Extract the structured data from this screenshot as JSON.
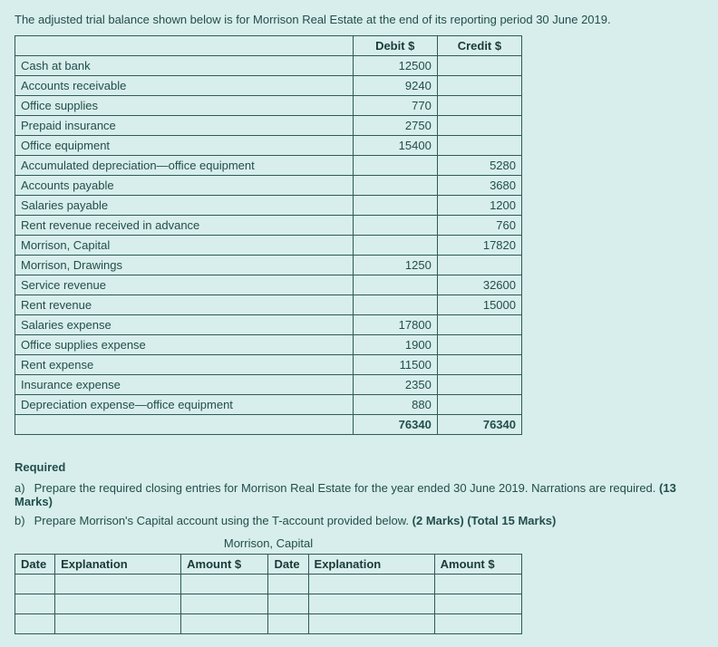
{
  "intro": "The adjusted trial balance shown below is for Morrison Real Estate at the end of its reporting period 30 June 2019.",
  "trial": {
    "headers": {
      "blank": "",
      "debit": "Debit $",
      "credit": "Credit $"
    },
    "rows": [
      {
        "acct": "Cash at bank",
        "debit": "12500",
        "credit": ""
      },
      {
        "acct": "Accounts receivable",
        "debit": "9240",
        "credit": ""
      },
      {
        "acct": "Office supplies",
        "debit": "770",
        "credit": ""
      },
      {
        "acct": "Prepaid insurance",
        "debit": "2750",
        "credit": ""
      },
      {
        "acct": "Office equipment",
        "debit": "15400",
        "credit": ""
      },
      {
        "acct": "Accumulated depreciation—office equipment",
        "debit": "",
        "credit": "5280"
      },
      {
        "acct": "Accounts payable",
        "debit": "",
        "credit": "3680"
      },
      {
        "acct": "Salaries payable",
        "debit": "",
        "credit": "1200"
      },
      {
        "acct": "Rent revenue received in advance",
        "debit": "",
        "credit": "760"
      },
      {
        "acct": "Morrison, Capital",
        "debit": "",
        "credit": "17820"
      },
      {
        "acct": "Morrison, Drawings",
        "debit": "1250",
        "credit": ""
      },
      {
        "acct": "Service revenue",
        "debit": "",
        "credit": "32600"
      },
      {
        "acct": "Rent revenue",
        "debit": "",
        "credit": "15000"
      },
      {
        "acct": "Salaries expense",
        "debit": "17800",
        "credit": ""
      },
      {
        "acct": "Office supplies expense",
        "debit": "1900",
        "credit": ""
      },
      {
        "acct": "Rent expense",
        "debit": "11500",
        "credit": ""
      },
      {
        "acct": "Insurance expense",
        "debit": "2350",
        "credit": ""
      },
      {
        "acct": "Depreciation expense—office equipment",
        "debit": "880",
        "credit": ""
      }
    ],
    "totals": {
      "acct": "",
      "debit": "76340",
      "credit": "76340"
    }
  },
  "required": {
    "heading": "Required",
    "a": {
      "lbl": "a)",
      "text": "Prepare the required closing entries for Morrison Real Estate for the year ended 30 June 2019. Narrations are required. ",
      "marks": "(13 Marks)"
    },
    "b": {
      "lbl": "b)",
      "text": "Prepare Morrison's Capital account using the T-account provided below. ",
      "marks": "(2 Marks) (Total 15 Marks)"
    }
  },
  "taccount": {
    "title": "Morrison, Capital",
    "headers": {
      "date1": "Date",
      "exp1": "Explanation",
      "amt1": "Amount $",
      "date2": "Date",
      "exp2": "Explanation",
      "amt2": "Amount $"
    },
    "rows": 3
  }
}
